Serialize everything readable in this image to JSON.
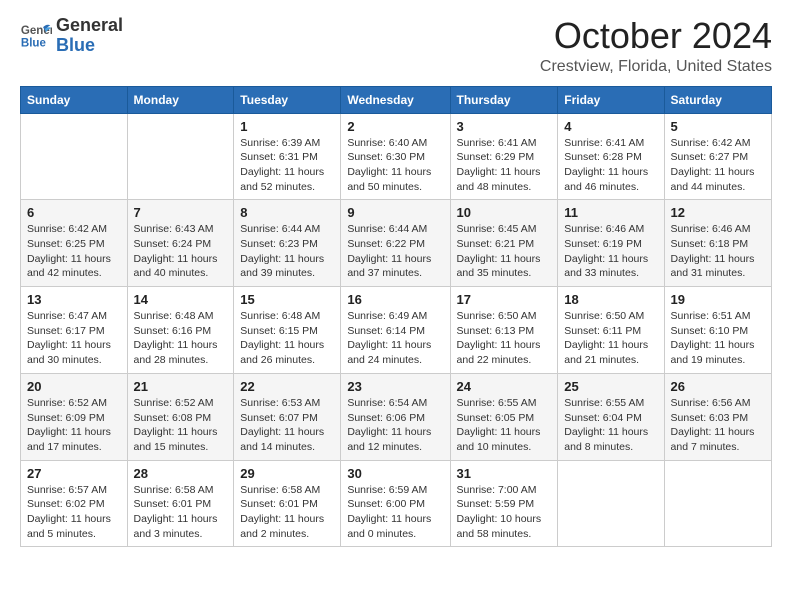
{
  "header": {
    "logo_general": "General",
    "logo_blue": "Blue",
    "month": "October 2024",
    "location": "Crestview, Florida, United States"
  },
  "days_of_week": [
    "Sunday",
    "Monday",
    "Tuesday",
    "Wednesday",
    "Thursday",
    "Friday",
    "Saturday"
  ],
  "weeks": [
    [
      {
        "day": "",
        "sunrise": "",
        "sunset": "",
        "daylight": ""
      },
      {
        "day": "",
        "sunrise": "",
        "sunset": "",
        "daylight": ""
      },
      {
        "day": "1",
        "sunrise": "Sunrise: 6:39 AM",
        "sunset": "Sunset: 6:31 PM",
        "daylight": "Daylight: 11 hours and 52 minutes."
      },
      {
        "day": "2",
        "sunrise": "Sunrise: 6:40 AM",
        "sunset": "Sunset: 6:30 PM",
        "daylight": "Daylight: 11 hours and 50 minutes."
      },
      {
        "day": "3",
        "sunrise": "Sunrise: 6:41 AM",
        "sunset": "Sunset: 6:29 PM",
        "daylight": "Daylight: 11 hours and 48 minutes."
      },
      {
        "day": "4",
        "sunrise": "Sunrise: 6:41 AM",
        "sunset": "Sunset: 6:28 PM",
        "daylight": "Daylight: 11 hours and 46 minutes."
      },
      {
        "day": "5",
        "sunrise": "Sunrise: 6:42 AM",
        "sunset": "Sunset: 6:27 PM",
        "daylight": "Daylight: 11 hours and 44 minutes."
      }
    ],
    [
      {
        "day": "6",
        "sunrise": "Sunrise: 6:42 AM",
        "sunset": "Sunset: 6:25 PM",
        "daylight": "Daylight: 11 hours and 42 minutes."
      },
      {
        "day": "7",
        "sunrise": "Sunrise: 6:43 AM",
        "sunset": "Sunset: 6:24 PM",
        "daylight": "Daylight: 11 hours and 40 minutes."
      },
      {
        "day": "8",
        "sunrise": "Sunrise: 6:44 AM",
        "sunset": "Sunset: 6:23 PM",
        "daylight": "Daylight: 11 hours and 39 minutes."
      },
      {
        "day": "9",
        "sunrise": "Sunrise: 6:44 AM",
        "sunset": "Sunset: 6:22 PM",
        "daylight": "Daylight: 11 hours and 37 minutes."
      },
      {
        "day": "10",
        "sunrise": "Sunrise: 6:45 AM",
        "sunset": "Sunset: 6:21 PM",
        "daylight": "Daylight: 11 hours and 35 minutes."
      },
      {
        "day": "11",
        "sunrise": "Sunrise: 6:46 AM",
        "sunset": "Sunset: 6:19 PM",
        "daylight": "Daylight: 11 hours and 33 minutes."
      },
      {
        "day": "12",
        "sunrise": "Sunrise: 6:46 AM",
        "sunset": "Sunset: 6:18 PM",
        "daylight": "Daylight: 11 hours and 31 minutes."
      }
    ],
    [
      {
        "day": "13",
        "sunrise": "Sunrise: 6:47 AM",
        "sunset": "Sunset: 6:17 PM",
        "daylight": "Daylight: 11 hours and 30 minutes."
      },
      {
        "day": "14",
        "sunrise": "Sunrise: 6:48 AM",
        "sunset": "Sunset: 6:16 PM",
        "daylight": "Daylight: 11 hours and 28 minutes."
      },
      {
        "day": "15",
        "sunrise": "Sunrise: 6:48 AM",
        "sunset": "Sunset: 6:15 PM",
        "daylight": "Daylight: 11 hours and 26 minutes."
      },
      {
        "day": "16",
        "sunrise": "Sunrise: 6:49 AM",
        "sunset": "Sunset: 6:14 PM",
        "daylight": "Daylight: 11 hours and 24 minutes."
      },
      {
        "day": "17",
        "sunrise": "Sunrise: 6:50 AM",
        "sunset": "Sunset: 6:13 PM",
        "daylight": "Daylight: 11 hours and 22 minutes."
      },
      {
        "day": "18",
        "sunrise": "Sunrise: 6:50 AM",
        "sunset": "Sunset: 6:11 PM",
        "daylight": "Daylight: 11 hours and 21 minutes."
      },
      {
        "day": "19",
        "sunrise": "Sunrise: 6:51 AM",
        "sunset": "Sunset: 6:10 PM",
        "daylight": "Daylight: 11 hours and 19 minutes."
      }
    ],
    [
      {
        "day": "20",
        "sunrise": "Sunrise: 6:52 AM",
        "sunset": "Sunset: 6:09 PM",
        "daylight": "Daylight: 11 hours and 17 minutes."
      },
      {
        "day": "21",
        "sunrise": "Sunrise: 6:52 AM",
        "sunset": "Sunset: 6:08 PM",
        "daylight": "Daylight: 11 hours and 15 minutes."
      },
      {
        "day": "22",
        "sunrise": "Sunrise: 6:53 AM",
        "sunset": "Sunset: 6:07 PM",
        "daylight": "Daylight: 11 hours and 14 minutes."
      },
      {
        "day": "23",
        "sunrise": "Sunrise: 6:54 AM",
        "sunset": "Sunset: 6:06 PM",
        "daylight": "Daylight: 11 hours and 12 minutes."
      },
      {
        "day": "24",
        "sunrise": "Sunrise: 6:55 AM",
        "sunset": "Sunset: 6:05 PM",
        "daylight": "Daylight: 11 hours and 10 minutes."
      },
      {
        "day": "25",
        "sunrise": "Sunrise: 6:55 AM",
        "sunset": "Sunset: 6:04 PM",
        "daylight": "Daylight: 11 hours and 8 minutes."
      },
      {
        "day": "26",
        "sunrise": "Sunrise: 6:56 AM",
        "sunset": "Sunset: 6:03 PM",
        "daylight": "Daylight: 11 hours and 7 minutes."
      }
    ],
    [
      {
        "day": "27",
        "sunrise": "Sunrise: 6:57 AM",
        "sunset": "Sunset: 6:02 PM",
        "daylight": "Daylight: 11 hours and 5 minutes."
      },
      {
        "day": "28",
        "sunrise": "Sunrise: 6:58 AM",
        "sunset": "Sunset: 6:01 PM",
        "daylight": "Daylight: 11 hours and 3 minutes."
      },
      {
        "day": "29",
        "sunrise": "Sunrise: 6:58 AM",
        "sunset": "Sunset: 6:01 PM",
        "daylight": "Daylight: 11 hours and 2 minutes."
      },
      {
        "day": "30",
        "sunrise": "Sunrise: 6:59 AM",
        "sunset": "Sunset: 6:00 PM",
        "daylight": "Daylight: 11 hours and 0 minutes."
      },
      {
        "day": "31",
        "sunrise": "Sunrise: 7:00 AM",
        "sunset": "Sunset: 5:59 PM",
        "daylight": "Daylight: 10 hours and 58 minutes."
      },
      {
        "day": "",
        "sunrise": "",
        "sunset": "",
        "daylight": ""
      },
      {
        "day": "",
        "sunrise": "",
        "sunset": "",
        "daylight": ""
      }
    ]
  ]
}
